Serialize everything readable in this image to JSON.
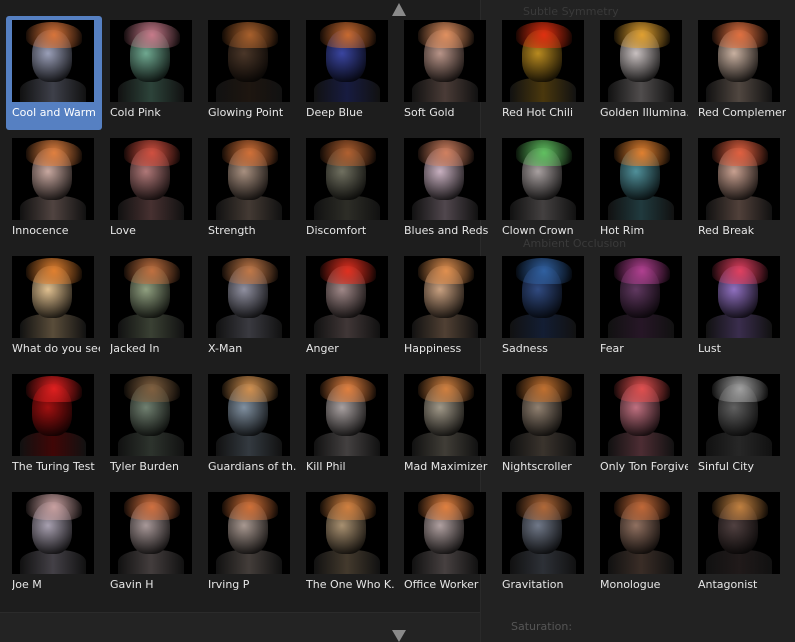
{
  "background_text": [
    "Subtle Symmetry",
    "Saturation:",
    "Ambient Occlusion"
  ],
  "selected": "Cool and Warm",
  "presets": [
    {
      "label": "Cool and Warm",
      "tint": "#9a9fb8",
      "hair": "#d8743a"
    },
    {
      "label": "Cold Pink",
      "tint": "#6fa890",
      "hair": "#c77a8a"
    },
    {
      "label": "Glowing Point",
      "tint": "#4a3628",
      "hair": "#a8602c"
    },
    {
      "label": "Deep Blue",
      "tint": "#3a45a0",
      "hair": "#c86a30"
    },
    {
      "label": "Soft Gold",
      "tint": "#b89488",
      "hair": "#e09060"
    },
    {
      "label": "Red Hot Chili",
      "tint": "#b88a20",
      "hair": "#e03010"
    },
    {
      "label": "Golden Illumina...",
      "tint": "#c8c0c0",
      "hair": "#e0a030"
    },
    {
      "label": "Red Complement",
      "tint": "#c8b0a0",
      "hair": "#e07040"
    },
    {
      "label": "Innocence",
      "tint": "#c8a8a0",
      "hair": "#e08040"
    },
    {
      "label": "Love",
      "tint": "#b07878",
      "hair": "#d05040"
    },
    {
      "label": "Strength",
      "tint": "#a89080",
      "hair": "#d07038"
    },
    {
      "label": "Discomfort",
      "tint": "#707060",
      "hair": "#b06030"
    },
    {
      "label": "Blues and Reds",
      "tint": "#c8b0c0",
      "hair": "#d08060"
    },
    {
      "label": "Clown Crown",
      "tint": "#a8a0a0",
      "hair": "#60c060"
    },
    {
      "label": "Hot Rim",
      "tint": "#50909a",
      "hair": "#e08030"
    },
    {
      "label": "Red Break",
      "tint": "#c8a090",
      "hair": "#e06040"
    },
    {
      "label": "What do you see",
      "tint": "#e0c090",
      "hair": "#e08030"
    },
    {
      "label": "Jacked In",
      "tint": "#90a080",
      "hair": "#c07040"
    },
    {
      "label": "X-Man",
      "tint": "#9090a0",
      "hair": "#c07848"
    },
    {
      "label": "Anger",
      "tint": "#a08888",
      "hair": "#e03020"
    },
    {
      "label": "Happiness",
      "tint": "#c8a080",
      "hair": "#e09050"
    },
    {
      "label": "Sadness",
      "tint": "#304a80",
      "hair": "#3060a0"
    },
    {
      "label": "Fear",
      "tint": "#603860",
      "hair": "#b04090"
    },
    {
      "label": "Lust",
      "tint": "#9070c0",
      "hair": "#e04060"
    },
    {
      "label": "The Turing Test",
      "tint": "#a01010",
      "hair": "#e02020"
    },
    {
      "label": "Tyler Burden",
      "tint": "#708070",
      "hair": "#806040"
    },
    {
      "label": "Guardians of th...",
      "tint": "#8090a0",
      "hair": "#d09050"
    },
    {
      "label": "Kill Phil",
      "tint": "#a8a0a0",
      "hair": "#e08040"
    },
    {
      "label": "Mad Maximizer",
      "tint": "#a09888",
      "hair": "#d08040"
    },
    {
      "label": "Nightscroller",
      "tint": "#908070",
      "hair": "#c07030"
    },
    {
      "label": "Only Ton Forgives",
      "tint": "#c07080",
      "hair": "#e05050"
    },
    {
      "label": "Sinful City",
      "tint": "#606060",
      "hair": "#a0a0a0"
    },
    {
      "label": "Joe M",
      "tint": "#a8a0b0",
      "hair": "#c8a0a0"
    },
    {
      "label": "Gavin H",
      "tint": "#a89898",
      "hair": "#d07040"
    },
    {
      "label": "Irving P",
      "tint": "#a89890",
      "hair": "#d07038"
    },
    {
      "label": "The One Who K...",
      "tint": "#a89070",
      "hair": "#d08040"
    },
    {
      "label": "Office Worker",
      "tint": "#b0a0a0",
      "hair": "#e08040"
    },
    {
      "label": "Gravitation",
      "tint": "#707888",
      "hair": "#b06838"
    },
    {
      "label": "Monologue",
      "tint": "#907060",
      "hair": "#c06838"
    },
    {
      "label": "Antagonist",
      "tint": "#504040",
      "hair": "#c08040"
    }
  ]
}
